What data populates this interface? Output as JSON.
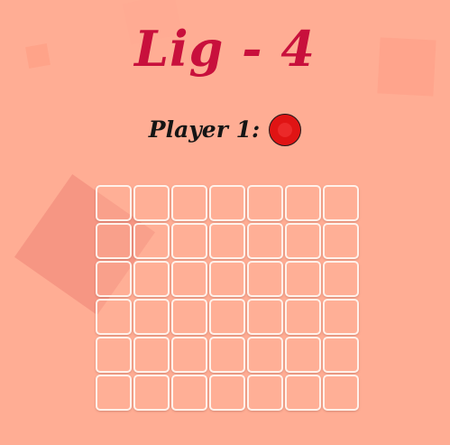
{
  "game": {
    "title": "Lig - 4",
    "status_label": "Player 1:",
    "current_player_color": "#e01414"
  },
  "board": {
    "rows": 6,
    "columns": 7,
    "cells": [
      [
        "",
        "",
        "",
        "",
        "",
        "",
        ""
      ],
      [
        "",
        "",
        "",
        "",
        "",
        "",
        ""
      ],
      [
        "",
        "",
        "",
        "",
        "",
        "",
        ""
      ],
      [
        "",
        "",
        "",
        "",
        "",
        "",
        ""
      ],
      [
        "",
        "",
        "",
        "",
        "",
        "",
        ""
      ],
      [
        "",
        "",
        "",
        "",
        "",
        "",
        ""
      ]
    ]
  },
  "colors": {
    "background": "#ffad94",
    "title": "#c8103c",
    "cell_border": "#fff1ea",
    "player1_disc": "#e01414"
  }
}
